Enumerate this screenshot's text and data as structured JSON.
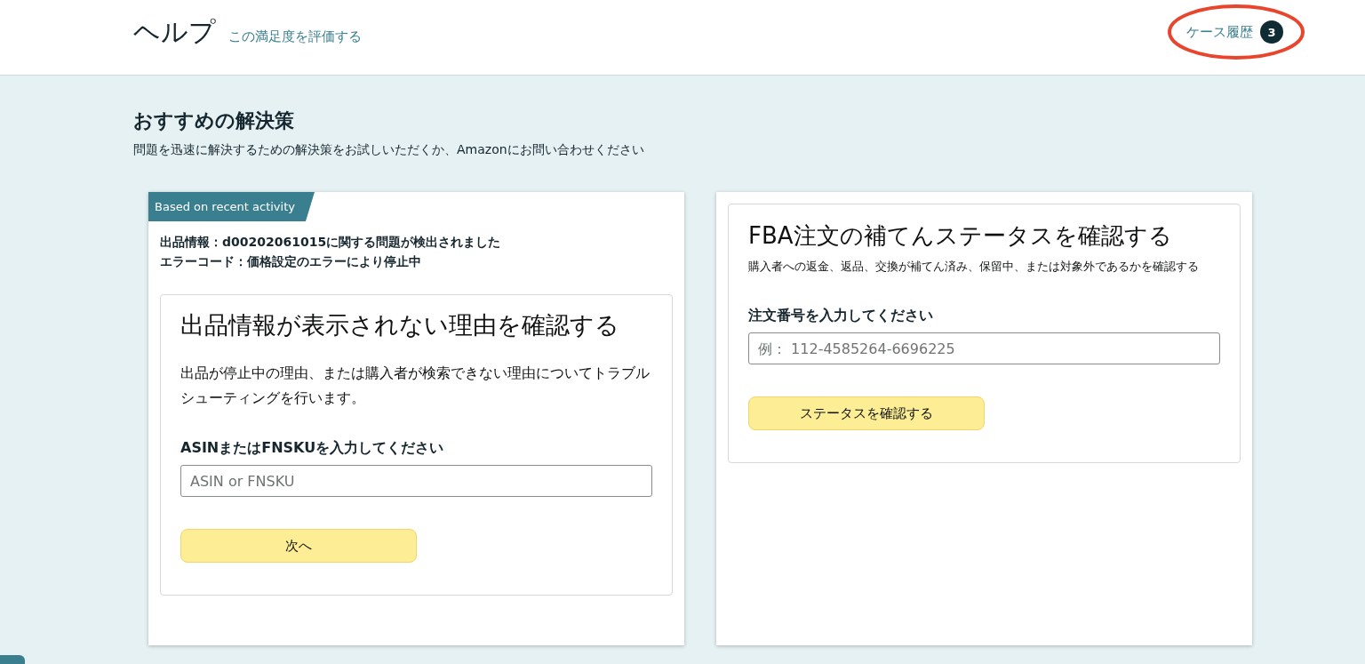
{
  "header": {
    "title": "ヘルプ",
    "rate_link": "この満足度を評価する",
    "case_history": {
      "label": "ケース履歴",
      "count": "3"
    },
    "annotation": {
      "kind": "ellipse"
    }
  },
  "section": {
    "title": "おすすめの解決策",
    "subtitle": "問題を迅速に解決するための解決策をお試しいただくか、Amazonにお問い合わせください"
  },
  "cards": [
    {
      "badge": "Based on recent activity",
      "alerts": [
        "出品情報：d00202061015に関する問題が検出されました",
        "エラーコード：価格設定のエラーにより停止中"
      ],
      "panel": {
        "title": "出品情報が表示されない理由を確認する",
        "description": "出品が停止中の理由、または購入者が検索できない理由についてトラブルシューティングを行います。",
        "field_label": "ASINまたはFNSKUを入力してください",
        "placeholder": "ASIN or FNSKU",
        "button": "次へ"
      }
    },
    {
      "panel": {
        "title": "FBA注文の補てんステータスを確認する",
        "description": "購入者への返金、返品、交換が補てん済み、保留中、または対象外であるかを確認する",
        "field_label": "注文番号を入力してください",
        "placeholder": "例： 112-4585264-6696225",
        "button": "ステータスを確認する"
      }
    }
  ]
}
